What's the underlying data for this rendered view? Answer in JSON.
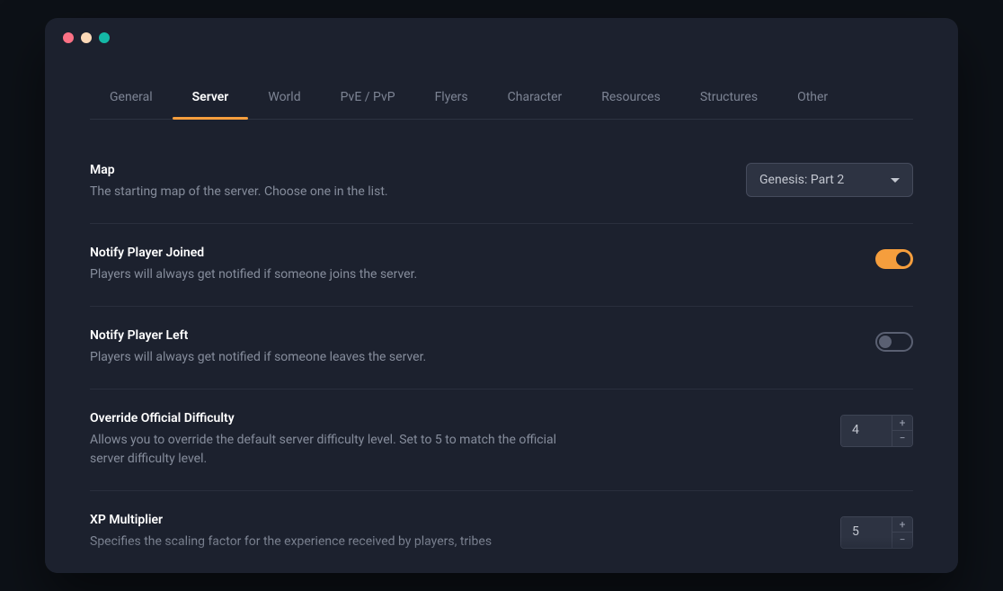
{
  "tabs": [
    "General",
    "Server",
    "World",
    "PvE / PvP",
    "Flyers",
    "Character",
    "Resources",
    "Structures",
    "Other"
  ],
  "active_tab_index": 1,
  "settings": {
    "map": {
      "title": "Map",
      "desc": "The starting map of the server. Choose one in the list.",
      "value": "Genesis: Part 2"
    },
    "notify_joined": {
      "title": "Notify Player Joined",
      "desc": "Players will always get notified if someone joins the server.",
      "value": true
    },
    "notify_left": {
      "title": "Notify Player Left",
      "desc": "Players will always get notified if someone leaves the server.",
      "value": false
    },
    "override_difficulty": {
      "title": "Override Official Difficulty",
      "desc": "Allows you to override the default server difficulty level. Set to 5 to match the official server difficulty level.",
      "value": "4"
    },
    "xp_multiplier": {
      "title": "XP Multiplier",
      "desc": "Specifies the scaling factor for the experience received by players, tribes",
      "value": "5"
    }
  },
  "stepper_icons": {
    "plus": "+",
    "minus": "−"
  }
}
